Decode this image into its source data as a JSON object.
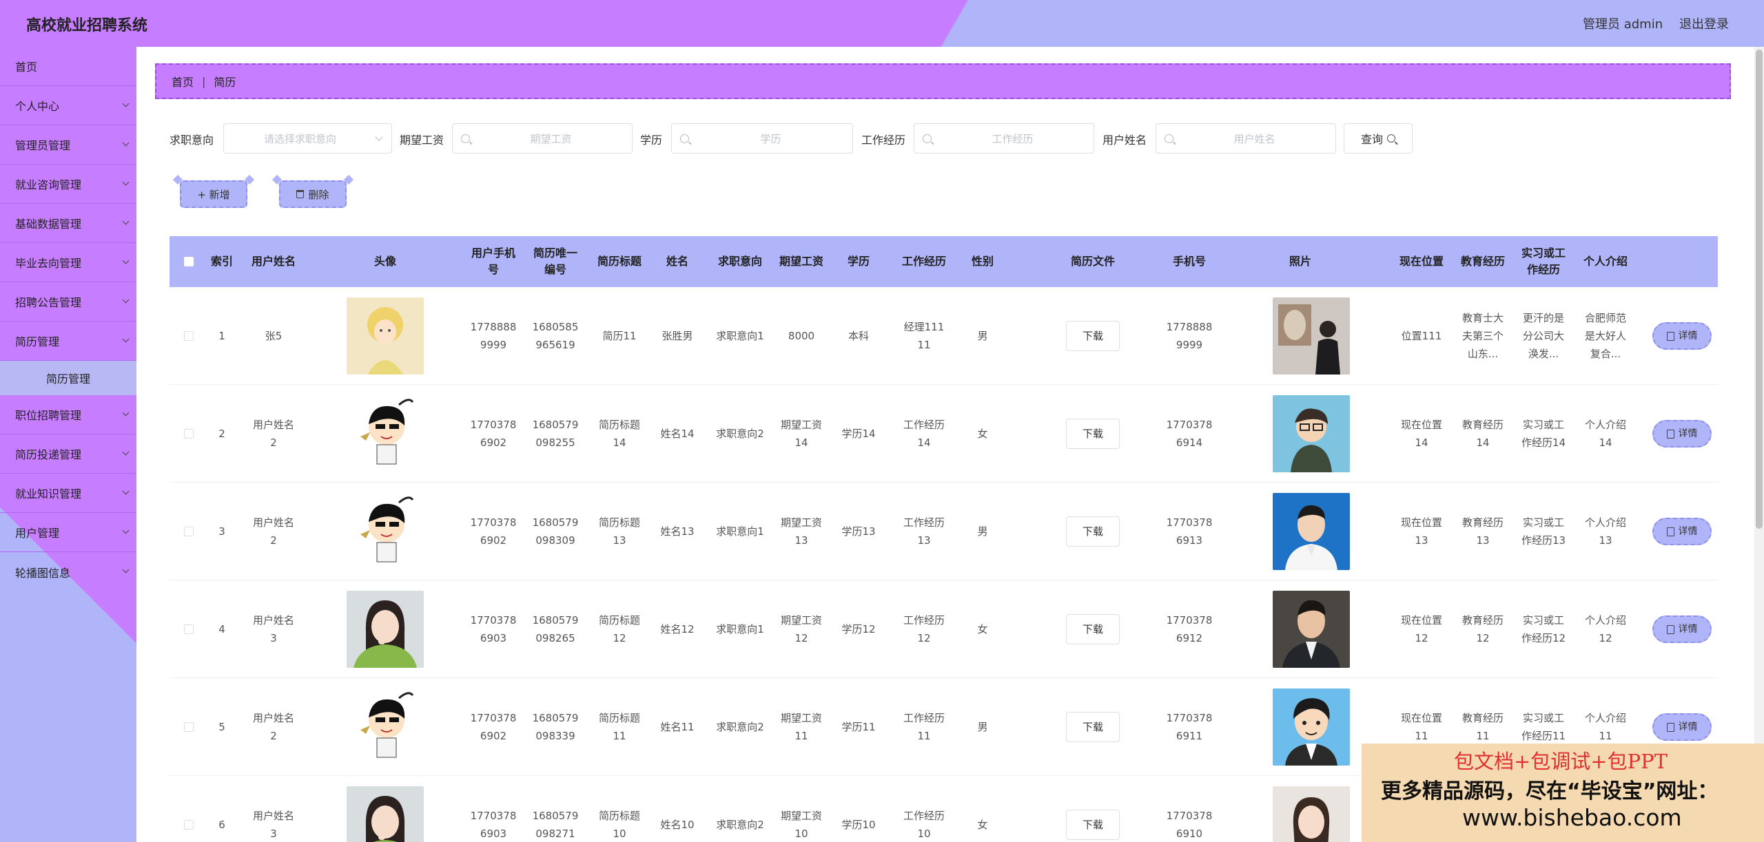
{
  "header": {
    "title": "高校就业招聘系统",
    "admin": "管理员 admin",
    "logout": "退出登录"
  },
  "sidebar": {
    "items": [
      {
        "label": "首页",
        "arrow": false
      },
      {
        "label": "个人中心",
        "arrow": true
      },
      {
        "label": "管理员管理",
        "arrow": true
      },
      {
        "label": "就业咨询管理",
        "arrow": true
      },
      {
        "label": "基础数据管理",
        "arrow": true
      },
      {
        "label": "毕业去向管理",
        "arrow": true
      },
      {
        "label": "招聘公告管理",
        "arrow": true
      },
      {
        "label": "简历管理",
        "arrow": true
      },
      {
        "label": "职位招聘管理",
        "arrow": true
      },
      {
        "label": "简历投递管理",
        "arrow": true
      },
      {
        "label": "就业知识管理",
        "arrow": true
      },
      {
        "label": "用户管理",
        "arrow": true
      },
      {
        "label": "轮播图信息",
        "arrow": true
      }
    ],
    "submenu": "简历管理"
  },
  "breadcrumb": {
    "home": "首页",
    "sep": "|",
    "current": "简历"
  },
  "search": {
    "intention_label": "求职意向",
    "intention_placeholder": "请选择求职意向",
    "salary_label": "期望工资",
    "salary_placeholder": "期望工资",
    "education_label": "学历",
    "education_placeholder": "学历",
    "experience_label": "工作经历",
    "experience_placeholder": "工作经历",
    "username_label": "用户姓名",
    "username_placeholder": "用户姓名",
    "query": "查询"
  },
  "actions": {
    "add": "+ 新增",
    "delete": "删除"
  },
  "table": {
    "headers": [
      "",
      "索引",
      "用户姓名",
      "头像",
      "用户手机号",
      "简历唯一编号",
      "简历标题",
      "姓名",
      "求职意向",
      "期望工资",
      "学历",
      "工作经历",
      "性别",
      "简历文件",
      "手机号",
      "照片",
      "现在位置",
      "教育经历",
      "实习或工作经历",
      "个人介绍",
      ""
    ],
    "download": "下载",
    "detail": "详情",
    "rows": [
      {
        "idx": "1",
        "user": "张5",
        "phone": "17788889999",
        "code": "1680585965619",
        "title": "简历11",
        "name": "张胜男",
        "intent": "求职意向1",
        "salary": "8000",
        "edu": "本科",
        "exp": "经理11111",
        "gender": "男",
        "mobile": "17788889999",
        "loc": "位置111",
        "eduexp": "教育士大夫第三个山东...",
        "work": "更汗的是分公司大涣发...",
        "intro": "合肥师范是大好人复合..."
      },
      {
        "idx": "2",
        "user": "用户姓名2",
        "phone": "17703786902",
        "code": "1680579098255",
        "title": "简历标题14",
        "name": "姓名14",
        "intent": "求职意向2",
        "salary": "期望工资14",
        "edu": "学历14",
        "exp": "工作经历14",
        "gender": "女",
        "mobile": "17703786914",
        "loc": "现在位置14",
        "eduexp": "教育经历14",
        "work": "实习或工作经历14",
        "intro": "个人介绍14"
      },
      {
        "idx": "3",
        "user": "用户姓名2",
        "phone": "17703786902",
        "code": "1680579098309",
        "title": "简历标题13",
        "name": "姓名13",
        "intent": "求职意向1",
        "salary": "期望工资13",
        "edu": "学历13",
        "exp": "工作经历13",
        "gender": "男",
        "mobile": "17703786913",
        "loc": "现在位置13",
        "eduexp": "教育经历13",
        "work": "实习或工作经历13",
        "intro": "个人介绍13"
      },
      {
        "idx": "4",
        "user": "用户姓名3",
        "phone": "17703786903",
        "code": "1680579098265",
        "title": "简历标题12",
        "name": "姓名12",
        "intent": "求职意向1",
        "salary": "期望工资12",
        "edu": "学历12",
        "exp": "工作经历12",
        "gender": "女",
        "mobile": "17703786912",
        "loc": "现在位置12",
        "eduexp": "教育经历12",
        "work": "实习或工作经历12",
        "intro": "个人介绍12"
      },
      {
        "idx": "5",
        "user": "用户姓名2",
        "phone": "17703786902",
        "code": "1680579098339",
        "title": "简历标题11",
        "name": "姓名11",
        "intent": "求职意向2",
        "salary": "期望工资11",
        "edu": "学历11",
        "exp": "工作经历11",
        "gender": "男",
        "mobile": "17703786911",
        "loc": "现在位置11",
        "eduexp": "教育经历11",
        "work": "实习或工作经历11",
        "intro": "个人介绍11"
      },
      {
        "idx": "6",
        "user": "用户姓名3",
        "phone": "17703786903",
        "code": "1680579098271",
        "title": "简历标题10",
        "name": "姓名10",
        "intent": "求职意向2",
        "salary": "期望工资10",
        "edu": "学历10",
        "exp": "工作经历10",
        "gender": "女",
        "mobile": "17703786910",
        "loc": "",
        "eduexp": "",
        "work": "",
        "intro": ""
      }
    ]
  },
  "watermark": {
    "line1": "包文档+包调试+包PPT",
    "line2": "更多精品源码，尽在“毕设宝”网址：",
    "line3": "www.bishebao.com"
  }
}
